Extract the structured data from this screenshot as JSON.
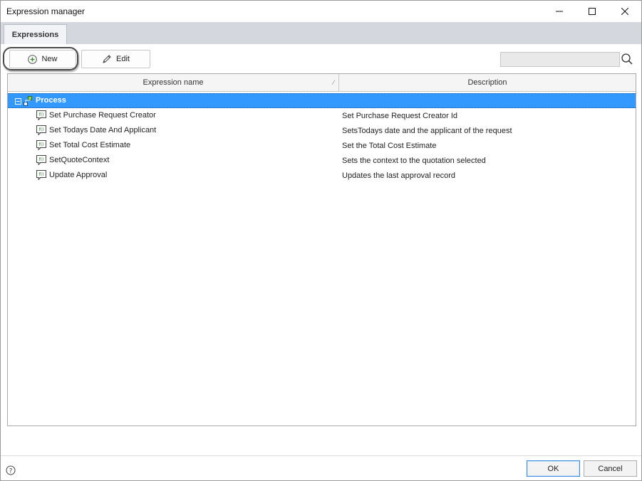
{
  "window": {
    "title": "Expression manager"
  },
  "tabs": [
    {
      "label": "Expressions",
      "active": true
    }
  ],
  "toolbar": {
    "new_label": "New",
    "edit_label": "Edit",
    "search": {
      "value": "",
      "placeholder": ""
    }
  },
  "grid": {
    "columns": [
      {
        "label": "Expression name"
      },
      {
        "label": "Description"
      }
    ],
    "groups": [
      {
        "label": "Process",
        "expanded": true,
        "selected": true,
        "items": [
          {
            "name": "Set Purchase Request Creator",
            "description": "Set Purchase Request Creator  Id"
          },
          {
            "name": "Set Todays Date And Applicant",
            "description": "SetsTodays date and the applicant of the request"
          },
          {
            "name": "Set Total Cost Estimate",
            "description": "Set the Total Cost Estimate"
          },
          {
            "name": "SetQuoteContext",
            "description": "Sets the context to the quotation selected"
          },
          {
            "name": "Update Approval",
            "description": "Updates the last approval record"
          }
        ]
      }
    ]
  },
  "footer": {
    "ok_label": "OK",
    "cancel_label": "Cancel"
  },
  "colors": {
    "selection": "#3399ff",
    "tabstrip": "#d4d8de",
    "new_icon": "#3c8a2e",
    "expr_icon": "#2e7d32"
  },
  "icons": {
    "new": "plus-circle-icon",
    "edit": "pencil-icon",
    "search": "search-icon",
    "group": "process-icon",
    "item": "expression-icon",
    "help": "help-icon"
  }
}
